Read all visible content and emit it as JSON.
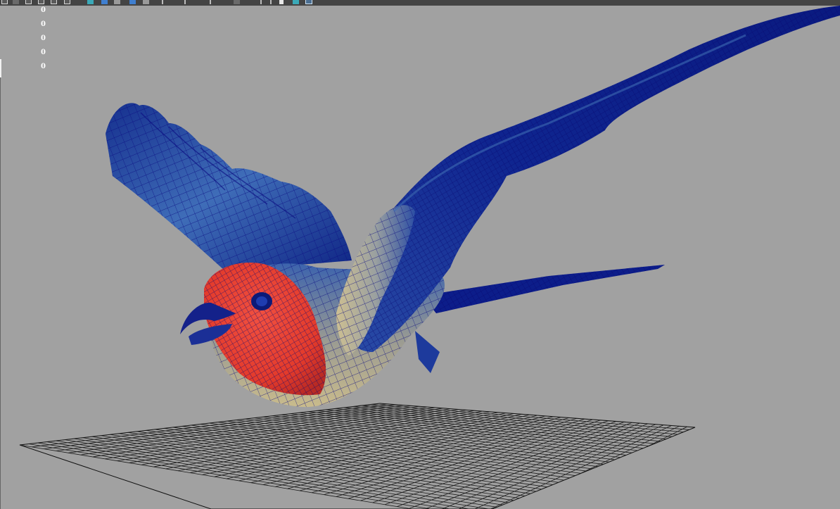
{
  "toolbar": {
    "icons": [
      "select-tool-icon",
      "lasso-tool-icon",
      "paint-tool-icon",
      "camera-icon",
      "view-icon",
      "layout-icon",
      "shaded-sphere-icon",
      "wireframe-cube-icon",
      "display-icon",
      "isolate-icon",
      "light-icon",
      "xray-icon",
      "slider-icon",
      "snap-icon",
      "grid-icon",
      "resolution-icon",
      "frame-icon"
    ]
  },
  "hud": {
    "values": [
      "0",
      "0",
      "0",
      "0",
      "0"
    ]
  },
  "viewport": {
    "background": "#a1a1a1",
    "grid_color": "#1a1a1a",
    "model": {
      "wing_color": "#0b1d86",
      "wing_highlight": "#3e6bb2",
      "breast_color": "#e43a2a",
      "belly_color": "#c7b98a",
      "wireframe_color": "#0a0a80"
    }
  }
}
